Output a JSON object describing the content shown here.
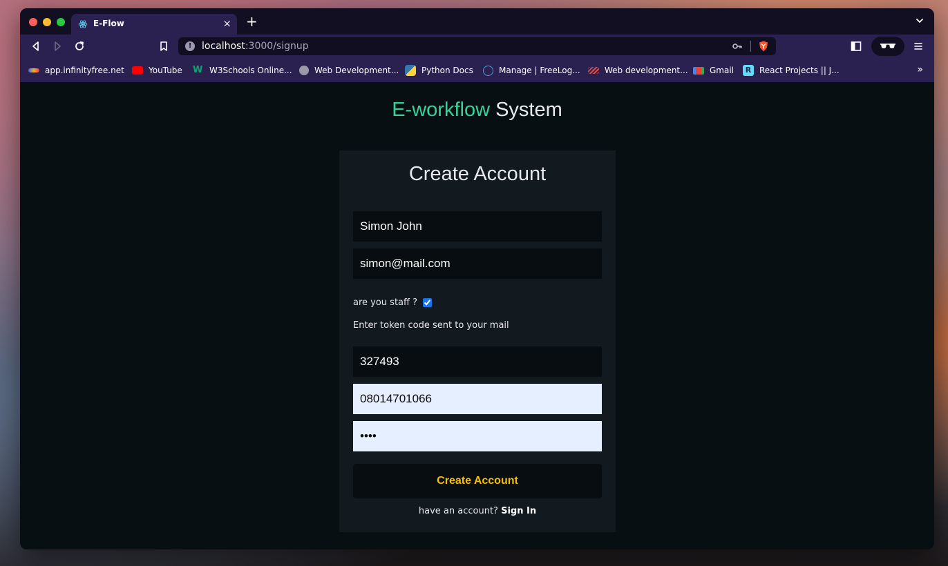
{
  "browser": {
    "tab": {
      "title": "E-Flow",
      "close_glyph": "×",
      "icon": "react-icon"
    },
    "new_tab_glyph": "+",
    "address": {
      "host": "localhost",
      "rest": ":3000/signup",
      "info_glyph": "!"
    },
    "bookmarks": [
      {
        "label": "app.infinityfree.net",
        "icon": "infinityfree-icon",
        "color": "#3da5f4"
      },
      {
        "label": "YouTube",
        "icon": "youtube-icon",
        "color": "#ff0000"
      },
      {
        "label": "W3Schools Online...",
        "icon": "w3schools-icon",
        "color": "#04aa6d"
      },
      {
        "label": "Web Development...",
        "icon": "globe-icon",
        "color": "#9a9aa8"
      },
      {
        "label": "Python Docs",
        "icon": "python-icon",
        "color": "#3776ab"
      },
      {
        "label": "Manage | FreeLog...",
        "icon": "freelogo-icon",
        "color": "#4a9fd8"
      },
      {
        "label": "Web development...",
        "icon": "webdev-icon",
        "color": "#e8473b"
      },
      {
        "label": "Gmail",
        "icon": "gmail-icon",
        "color": "#ea4335"
      },
      {
        "label": "React Projects || J...",
        "icon": "react-projects-icon",
        "color": "#61dafb"
      }
    ],
    "bookmarks_more_glyph": "»"
  },
  "page": {
    "brand_primary": "E-workflow",
    "brand_secondary": "System",
    "card_title": "Create Account",
    "fields": {
      "name": "Simon John",
      "email": "simon@mail.com",
      "token": "327493",
      "phone": "08014701066",
      "password": "pass"
    },
    "staff_label": "are you staff ?",
    "staff_checked": true,
    "token_hint": "Enter token code sent to your mail",
    "submit_label": "Create Account",
    "footer_prompt": "have an account?",
    "footer_link": "Sign In"
  },
  "colors": {
    "brand_accent": "#34d399",
    "button_text": "#f6c000",
    "page_bg": "#070f13",
    "card_bg": "#121a20",
    "browser_chrome": "#2b2150"
  }
}
